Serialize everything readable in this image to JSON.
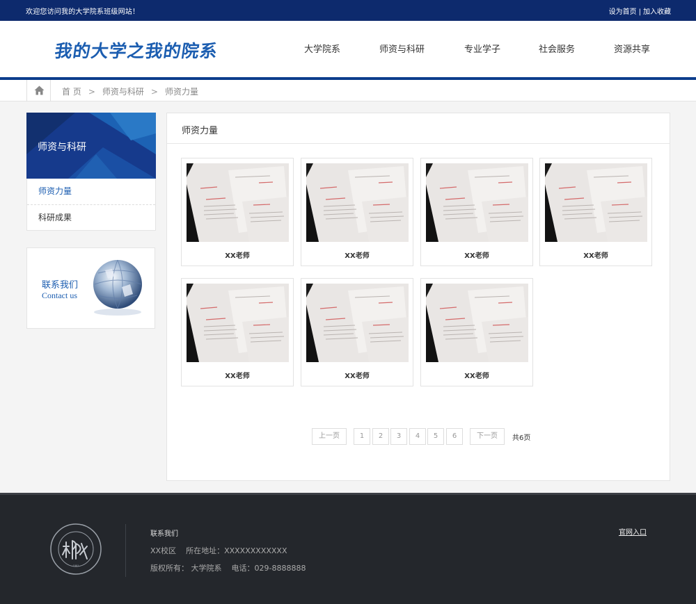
{
  "topbar": {
    "welcome": "欢迎您访问我的大学院系班级网站！",
    "set_home": "设为首页",
    "separator": "|",
    "add_favorite": "加入收藏"
  },
  "header": {
    "logo": "我的大学之我的院系",
    "nav": [
      "大学院系",
      "师资与科研",
      "专业学子",
      "社会服务",
      "资源共享"
    ]
  },
  "breadcrumb": {
    "items": [
      "首 页",
      "师资与科研",
      "师资力量"
    ],
    "separator": ">"
  },
  "sidebar": {
    "title": "师资与科研",
    "items": [
      {
        "label": "师资力量",
        "active": true
      },
      {
        "label": "科研成果",
        "active": false
      }
    ],
    "contact": {
      "cn": "联系我们",
      "en": "Contact us"
    }
  },
  "content": {
    "title": "师资力量",
    "teachers": [
      {
        "name": "XX老师"
      },
      {
        "name": "XX老师"
      },
      {
        "name": "XX老师"
      },
      {
        "name": "XX老师"
      },
      {
        "name": "XX老师"
      },
      {
        "name": "XX老师"
      },
      {
        "name": "XX老师"
      }
    ]
  },
  "pagination": {
    "prev": "上一页",
    "pages": [
      "1",
      "2",
      "3",
      "4",
      "5",
      "6"
    ],
    "next": "下一页",
    "total": "共6页"
  },
  "footer": {
    "contact_title": "联系我们",
    "campus": "XX校区",
    "address": "所在地址：XXXXXXXXXXXX",
    "copyright": "版权所有： 大学院系",
    "phone": "电话：029-8888888",
    "official": "官网入口"
  },
  "colors": {
    "topbar": "#0d2a6d",
    "accent": "#1b5db0",
    "header_line": "#0d3d8c",
    "footer": "#24272c"
  }
}
